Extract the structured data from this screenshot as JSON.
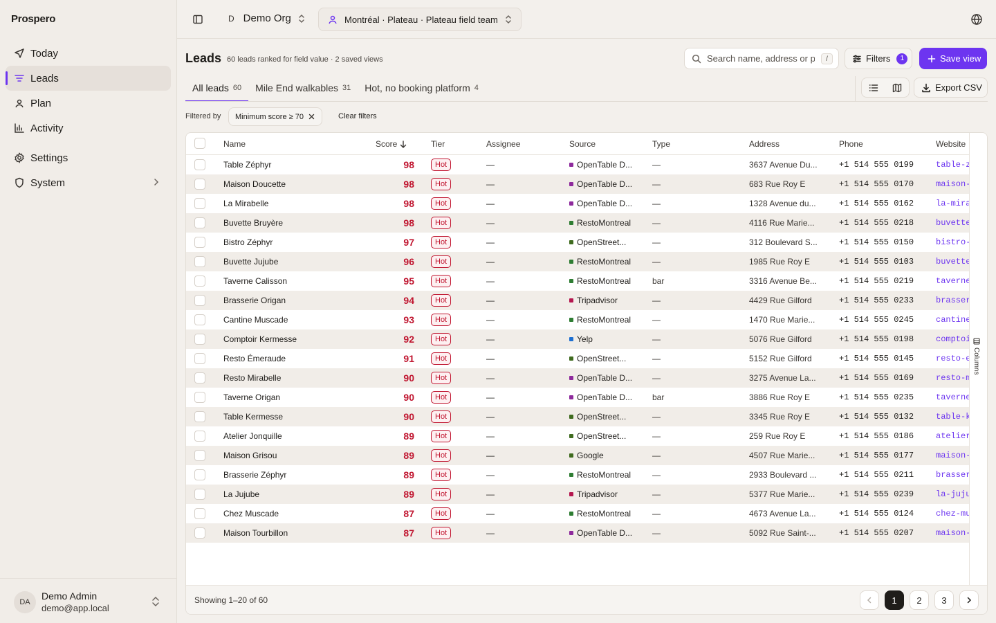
{
  "app": {
    "brand": "Prospero"
  },
  "sidebar": {
    "items": [
      {
        "label": "Today",
        "icon": "navigation-arrow-icon"
      },
      {
        "label": "Leads",
        "icon": "filter-lines-icon",
        "active": true
      },
      {
        "label": "Plan",
        "icon": "map-pin-icon"
      },
      {
        "label": "Activity",
        "icon": "bar-chart-icon"
      },
      {
        "label": "Settings",
        "icon": "gear-icon"
      },
      {
        "label": "System",
        "icon": "shield-icon"
      }
    ],
    "user": {
      "initials": "DA",
      "name": "Demo Admin",
      "email": "demo@app.local"
    }
  },
  "topbar": {
    "org_initial": "D",
    "org_name": "Demo Org",
    "team": "Montréal · Plateau · Plateau field team"
  },
  "header": {
    "title": "Leads",
    "subtitle": "60 leads ranked for field value · 2 saved views",
    "search_placeholder": "Search name, address or pl",
    "search_shortcut": "/",
    "filters_label": "Filters",
    "filters_count": "1",
    "save_view_label": "Save view",
    "export_label": "Export CSV"
  },
  "tabs": [
    {
      "label": "All leads",
      "count": "60",
      "active": true
    },
    {
      "label": "Mile End walkables",
      "count": "31"
    },
    {
      "label": "Hot, no booking platform",
      "count": "4"
    }
  ],
  "filters": {
    "prefix": "Filtered by",
    "chip": "Minimum score ≥ 70",
    "clear": "Clear filters"
  },
  "table": {
    "columns": [
      "Name",
      "Score",
      "Tier",
      "Assignee",
      "Source",
      "Type",
      "Address",
      "Phone",
      "Website"
    ],
    "rows": [
      {
        "name": "Table Zéphyr",
        "score": "98",
        "tier": "Hot",
        "assignee": "—",
        "source": "OpenTable D...",
        "source_color": "#8e2a9c",
        "type": "—",
        "address": "3637 Avenue Du...",
        "phone": "+1 514 555 0199",
        "website": "table-zep"
      },
      {
        "name": "Maison Doucette",
        "score": "98",
        "tier": "Hot",
        "assignee": "—",
        "source": "OpenTable D...",
        "source_color": "#8e2a9c",
        "type": "—",
        "address": "683 Rue Roy E",
        "phone": "+1 514 555 0170",
        "website": "maison-d"
      },
      {
        "name": "La Mirabelle",
        "score": "98",
        "tier": "Hot",
        "assignee": "—",
        "source": "OpenTable D...",
        "source_color": "#8e2a9c",
        "type": "—",
        "address": "1328 Avenue du...",
        "phone": "+1 514 555 0162",
        "website": "la-mirab"
      },
      {
        "name": "Buvette Bruyère",
        "score": "98",
        "tier": "Hot",
        "assignee": "—",
        "source": "RestoMontreal",
        "source_color": "#2e7d32",
        "type": "—",
        "address": "4116 Rue Marie...",
        "phone": "+1 514 555 0218",
        "website": "buvette-b"
      },
      {
        "name": "Bistro Zéphyr",
        "score": "97",
        "tier": "Hot",
        "assignee": "—",
        "source": "OpenStreet...",
        "source_color": "#3f6b1f",
        "type": "—",
        "address": "312 Boulevard S...",
        "phone": "+1 514 555 0150",
        "website": "bistro-ze"
      },
      {
        "name": "Buvette Jujube",
        "score": "96",
        "tier": "Hot",
        "assignee": "—",
        "source": "RestoMontreal",
        "source_color": "#2e7d32",
        "type": "—",
        "address": "1985 Rue Roy E",
        "phone": "+1 514 555 0103",
        "website": "buvette-j"
      },
      {
        "name": "Taverne Calisson",
        "score": "95",
        "tier": "Hot",
        "assignee": "—",
        "source": "RestoMontreal",
        "source_color": "#2e7d32",
        "type": "bar",
        "address": "3316 Avenue Be...",
        "phone": "+1 514 555 0219",
        "website": "taverne-c"
      },
      {
        "name": "Brasserie Origan",
        "score": "94",
        "tier": "Hot",
        "assignee": "—",
        "source": "Tripadvisor",
        "source_color": "#b5174f",
        "type": "—",
        "address": "4429 Rue Gilford",
        "phone": "+1 514 555 0233",
        "website": "brasserie"
      },
      {
        "name": "Cantine Muscade",
        "score": "93",
        "tier": "Hot",
        "assignee": "—",
        "source": "RestoMontreal",
        "source_color": "#2e7d32",
        "type": "—",
        "address": "1470 Rue Marie...",
        "phone": "+1 514 555 0245",
        "website": "cantine-m"
      },
      {
        "name": "Comptoir Kermesse",
        "score": "92",
        "tier": "Hot",
        "assignee": "—",
        "source": "Yelp",
        "source_color": "#1e6fd1",
        "type": "—",
        "address": "5076 Rue Gilford",
        "phone": "+1 514 555 0198",
        "website": "comptoir"
      },
      {
        "name": "Resto Émeraude",
        "score": "91",
        "tier": "Hot",
        "assignee": "—",
        "source": "OpenStreet...",
        "source_color": "#3f6b1f",
        "type": "—",
        "address": "5152 Rue Gilford",
        "phone": "+1 514 555 0145",
        "website": "resto-e-"
      },
      {
        "name": "Resto Mirabelle",
        "score": "90",
        "tier": "Hot",
        "assignee": "—",
        "source": "OpenTable D...",
        "source_color": "#8e2a9c",
        "type": "—",
        "address": "3275 Avenue La...",
        "phone": "+1 514 555 0169",
        "website": "resto-mi"
      },
      {
        "name": "Taverne Origan",
        "score": "90",
        "tier": "Hot",
        "assignee": "—",
        "source": "OpenTable D...",
        "source_color": "#8e2a9c",
        "type": "bar",
        "address": "3886 Rue Roy E",
        "phone": "+1 514 555 0235",
        "website": "taverne-o"
      },
      {
        "name": "Table Kermesse",
        "score": "90",
        "tier": "Hot",
        "assignee": "—",
        "source": "OpenStreet...",
        "source_color": "#3f6b1f",
        "type": "—",
        "address": "3345 Rue Roy E",
        "phone": "+1 514 555 0132",
        "website": "table-ker"
      },
      {
        "name": "Atelier Jonquille",
        "score": "89",
        "tier": "Hot",
        "assignee": "—",
        "source": "OpenStreet...",
        "source_color": "#3f6b1f",
        "type": "—",
        "address": "259 Rue Roy E",
        "phone": "+1 514 555 0186",
        "website": "atelier-jo"
      },
      {
        "name": "Maison Grisou",
        "score": "89",
        "tier": "Hot",
        "assignee": "—",
        "source": "Google",
        "source_color": "#3f6b1f",
        "type": "—",
        "address": "4507 Rue Marie...",
        "phone": "+1 514 555 0177",
        "website": "maison-g"
      },
      {
        "name": "Brasserie Zéphyr",
        "score": "89",
        "tier": "Hot",
        "assignee": "—",
        "source": "RestoMontreal",
        "source_color": "#2e7d32",
        "type": "—",
        "address": "2933 Boulevard ...",
        "phone": "+1 514 555 0211",
        "website": "brasserie"
      },
      {
        "name": "La Jujube",
        "score": "89",
        "tier": "Hot",
        "assignee": "—",
        "source": "Tripadvisor",
        "source_color": "#b5174f",
        "type": "—",
        "address": "5377 Rue Marie...",
        "phone": "+1 514 555 0239",
        "website": "la-jujube"
      },
      {
        "name": "Chez Muscade",
        "score": "87",
        "tier": "Hot",
        "assignee": "—",
        "source": "RestoMontreal",
        "source_color": "#2e7d32",
        "type": "—",
        "address": "4673 Avenue La...",
        "phone": "+1 514 555 0124",
        "website": "chez-mu"
      },
      {
        "name": "Maison Tourbillon",
        "score": "87",
        "tier": "Hot",
        "assignee": "—",
        "source": "OpenTable D...",
        "source_color": "#8e2a9c",
        "type": "—",
        "address": "5092 Rue Saint-...",
        "phone": "+1 514 555 0207",
        "website": "maison-t"
      }
    ],
    "columns_toggle": "Columns",
    "footer": {
      "showing": "Showing 1–20 of 60",
      "pages": [
        "1",
        "2",
        "3"
      ],
      "current_page": "1"
    }
  },
  "colors": {
    "accent": "#6d35f0",
    "hot": "#c0152f"
  }
}
